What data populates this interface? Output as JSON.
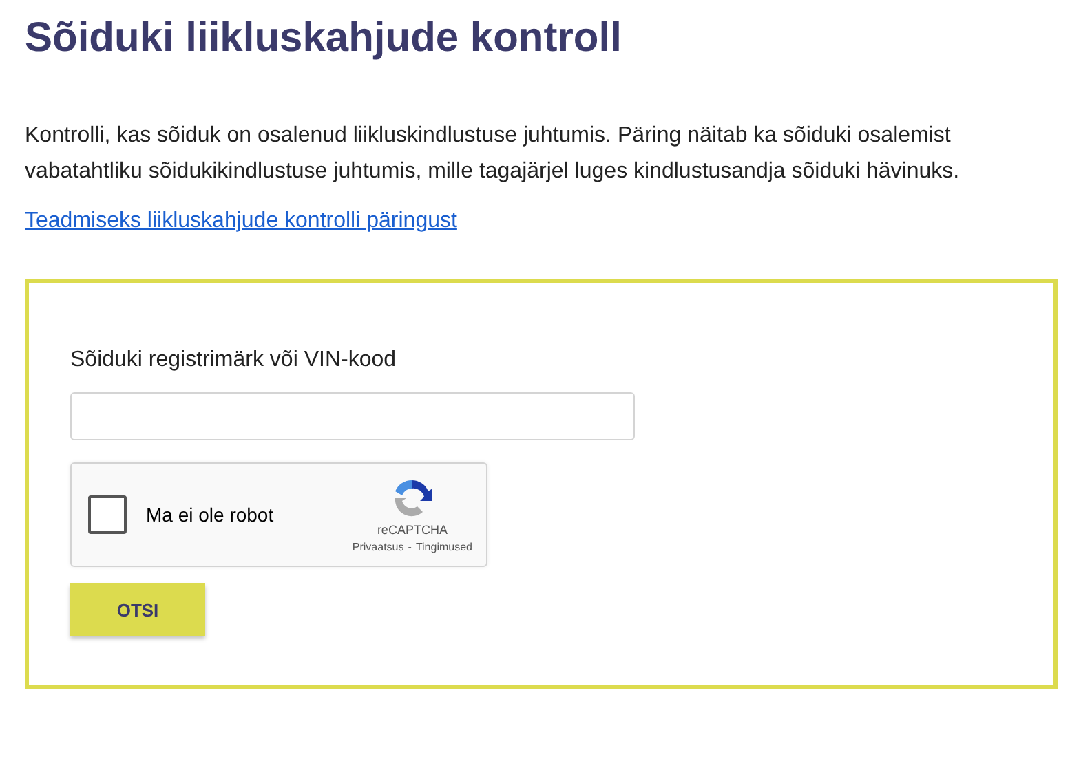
{
  "title": "Sõiduki liikluskahjude kontroll",
  "intro": "Kontrolli, kas sõiduk on osalenud liikluskindlustuse juhtumis. Päring näitab ka sõiduki osalemist vabatahtliku sõidukikindlustuse juhtumis, mille tagajärjel luges kindlustusandja sõiduki hävinuks.",
  "info_link": "Teadmiseks liikluskahjude kontrolli päringust",
  "form": {
    "field_label": "Sõiduki registrimärk või VIN-kood",
    "captcha": {
      "label": "Ma ei ole robot",
      "checked": false,
      "brand": "reCAPTCHA",
      "privacy_link": "Privaatsus",
      "separator": "-",
      "terms_link": "Tingimused"
    },
    "submit": "OTSI"
  }
}
